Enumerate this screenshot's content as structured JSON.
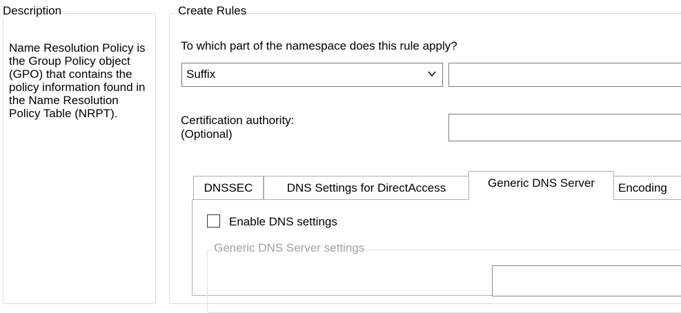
{
  "description": {
    "title": "Description",
    "body": "Name Resolution Policy is the Group Policy object (GPO) that contains the policy information found in the Name Resolution Policy Table (NRPT)."
  },
  "create_rules": {
    "title": "Create Rules",
    "namespace_question": "To which part of the namespace does this rule apply?",
    "namespace_selected": "Suffix",
    "namespace_value": "",
    "cert_label_line1": "Certification authority:",
    "cert_label_line2": "(Optional)",
    "cert_value": ""
  },
  "tabs": [
    {
      "label": "DNSSEC"
    },
    {
      "label": "DNS Settings for DirectAccess"
    },
    {
      "label": "Generic DNS Server"
    },
    {
      "label": "Encoding"
    }
  ],
  "generic_dns": {
    "enable_label": "Enable DNS settings",
    "enable_checked": false,
    "settings_group_title": "Generic DNS Server settings",
    "server_value": ""
  },
  "icons": {
    "dropdown": "chevron-down-icon"
  }
}
